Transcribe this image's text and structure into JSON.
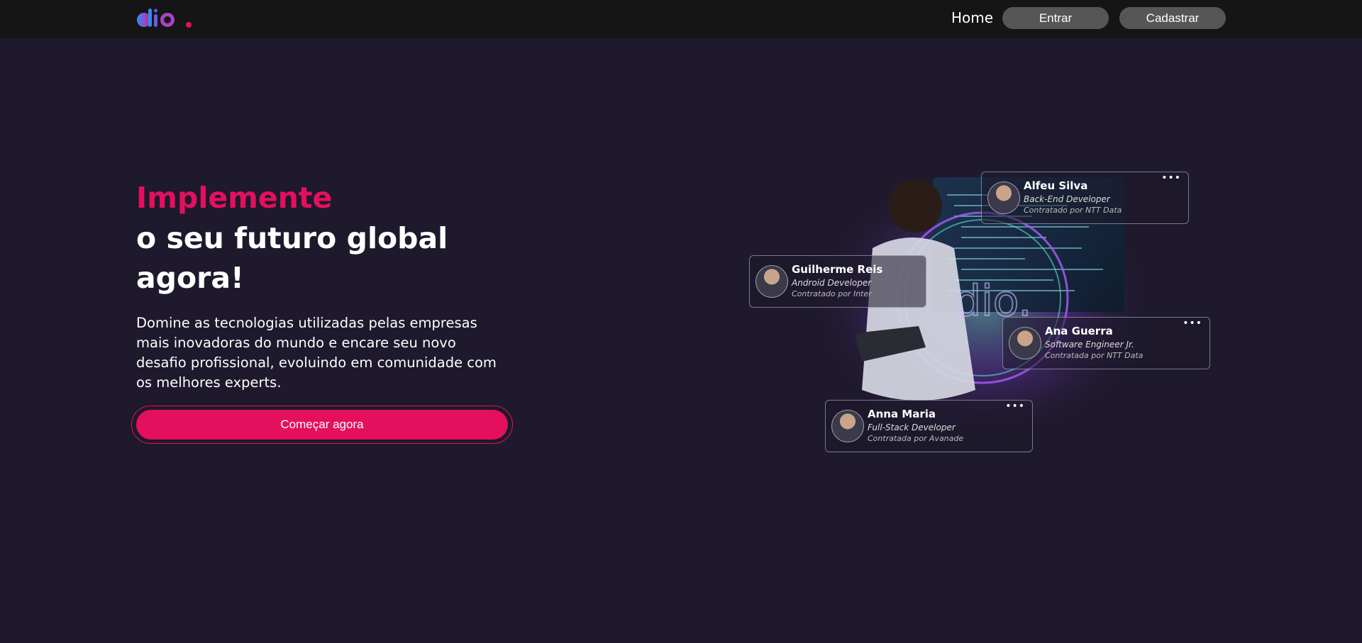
{
  "header": {
    "logo_text": "dio.",
    "nav_home": "Home",
    "login_label": "Entrar",
    "signup_label": "Cadastrar"
  },
  "hero": {
    "title_accent": "Implemente",
    "title_main": "o seu futuro global agora!",
    "description": "Domine as tecnologias utilizadas pelas empresas mais inovadoras do mundo e encare seu novo desafio profissional, evoluindo em comunidade com os melhores experts.",
    "cta_label": "Começar agora"
  },
  "profiles": [
    {
      "name": "Alfeu Silva",
      "role": "Back-End Developer",
      "company": "Contratado por NTT Data"
    },
    {
      "name": "Guilherme Reis",
      "role": "Android Developer",
      "company": "Contratado por Inter"
    },
    {
      "name": "Ana Guerra",
      "role": "Software Engineer Jr.",
      "company": "Contratada por NTT Data"
    },
    {
      "name": "Anna Maria",
      "role": "Full-Stack Developer",
      "company": "Contratada por Avanade"
    }
  ],
  "colors": {
    "background": "#1e192c",
    "header": "#151515",
    "accent": "#e4105d",
    "nav_button": "#565656"
  },
  "icons": {
    "card_menu": "more-dots-icon"
  }
}
